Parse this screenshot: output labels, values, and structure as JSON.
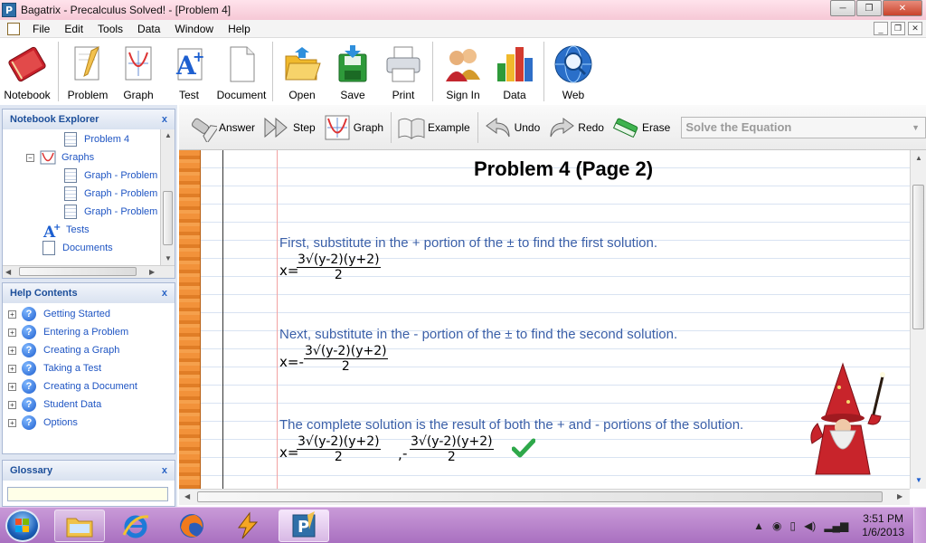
{
  "window": {
    "title": "Bagatrix - Precalculus Solved! - [Problem 4]",
    "app_icon_letter": "P",
    "minimize": "─",
    "maximize": "❐",
    "close": "✕"
  },
  "menu": {
    "items": [
      "File",
      "Edit",
      "Tools",
      "Data",
      "Window",
      "Help"
    ],
    "mdi_minimize": "_",
    "mdi_restore": "❐",
    "mdi_close": "✕"
  },
  "toolbar": {
    "buttons": [
      {
        "label": "Notebook",
        "icon": "notebook-icon"
      },
      {
        "label": "Problem",
        "icon": "problem-icon"
      },
      {
        "label": "Graph",
        "icon": "graph-icon"
      },
      {
        "label": "Test",
        "icon": "test-icon"
      },
      {
        "label": "Document",
        "icon": "document-icon"
      },
      {
        "label": "Open",
        "icon": "open-folder-icon"
      },
      {
        "label": "Save",
        "icon": "save-icon"
      },
      {
        "label": "Print",
        "icon": "printer-icon"
      },
      {
        "label": "Sign In",
        "icon": "users-icon"
      },
      {
        "label": "Data",
        "icon": "bar-chart-icon"
      },
      {
        "label": "Web",
        "icon": "globe-icon"
      }
    ]
  },
  "explorer": {
    "title": "Notebook Explorer",
    "close": "x",
    "items": [
      "Problem 4",
      "Graphs",
      "Graph - Problem",
      "Graph - Problem",
      "Graph - Problem",
      "Tests",
      "Documents"
    ],
    "collapse_sign": "−"
  },
  "help": {
    "title": "Help Contents",
    "close": "x",
    "expand_sign": "+",
    "items": [
      "Getting Started",
      "Entering a Problem",
      "Creating a Graph",
      "Taking a Test",
      "Creating a Document",
      "Student Data",
      "Options"
    ]
  },
  "glossary": {
    "title": "Glossary",
    "close": "x",
    "value": ""
  },
  "actionbar": {
    "answer": "Answer",
    "step": "Step",
    "graph": "Graph",
    "example": "Example",
    "undo": "Undo",
    "redo": "Redo",
    "erase": "Erase",
    "solve_select": "Solve the Equation"
  },
  "page": {
    "title": "Problem 4 (Page 2)",
    "step1": "First, substitute in the + portion of the ± to find the first solution.",
    "step2": "Next, substitute in the - portion of the ± to find the second solution.",
    "step3": "The complete solution is the result of both the + and - portions of the solution.",
    "x_eq": "x=",
    "x_eq_neg": "x=-",
    "neg": "-",
    "comma": ",",
    "numerator": "3√(y-2)(y+2)",
    "denominator": "2",
    "check_icon": "check-icon"
  },
  "taskbar": {
    "clock_time": "3:51 PM",
    "clock_date": "1/6/2013"
  },
  "colors": {
    "link_blue": "#1f55c3",
    "step_text": "#3a5fa8",
    "spine_orange": "#f2923a",
    "taskbar_purple": "#b57fca"
  }
}
